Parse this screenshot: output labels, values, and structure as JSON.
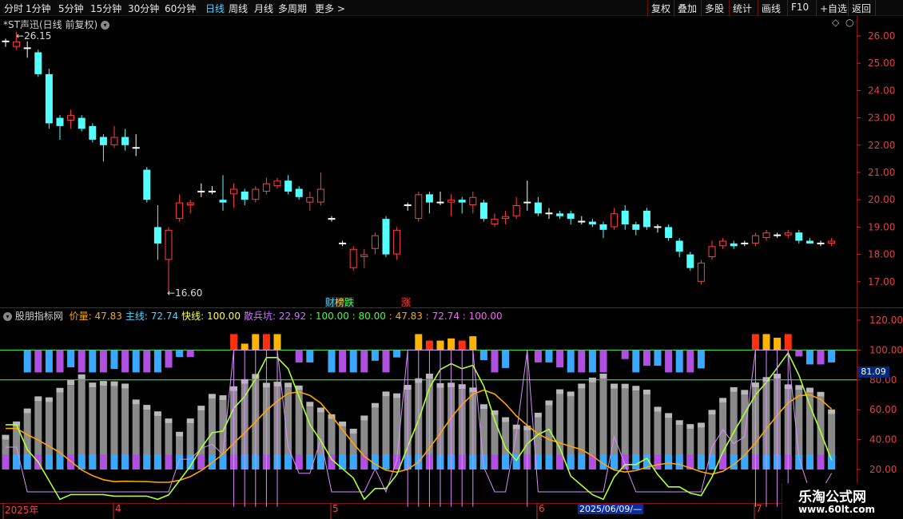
{
  "toolbar": {
    "periods": [
      "分时",
      "1分钟",
      "5分钟",
      "15分钟",
      "30分钟",
      "60分钟",
      "日线",
      "周线",
      "月线",
      "多周期",
      "更多 >"
    ],
    "active_period": "日线",
    "right_buttons": [
      "复权",
      "叠加",
      "多股",
      "统计",
      "画线",
      "F10",
      "+自选",
      "返回"
    ]
  },
  "main_chart": {
    "title": "*ST声迅(日线 前复权)",
    "high_label": "26.15",
    "low_label": "16.60",
    "event_labels": [
      {
        "text": "财",
        "color": "#2fd0ff"
      },
      {
        "text": "榜",
        "color": "#ffd21f"
      },
      {
        "text": "跌",
        "color": "#33ff55"
      },
      {
        "text": "涨",
        "color": "#ff3333"
      }
    ],
    "price_axis": [
      "26.00",
      "25.00",
      "24.00",
      "23.00",
      "22.00",
      "21.00",
      "20.00",
      "19.00",
      "18.00",
      "17.00"
    ]
  },
  "indicator": {
    "name": "股朋指标网",
    "items": [
      {
        "label": "价量:",
        "value": "47.83",
        "color": "#ffa500"
      },
      {
        "label": "主线:",
        "value": "72.74",
        "color": "#4fd2ff"
      },
      {
        "label": "快线:",
        "value": "100.00",
        "color": "#ffff40"
      },
      {
        "label": "散兵坑:",
        "value": "22.92",
        "color": "#d070ff"
      }
    ],
    "extra_values": [
      {
        "value": "100.00",
        "color": "#40ff40"
      },
      {
        "value": "80.00",
        "color": "#40ff40"
      },
      {
        "value": "47.83",
        "color": "#ffa500"
      },
      {
        "value": "72.74",
        "color": "#ff60ff"
      },
      {
        "value": "100.00",
        "color": "#ff60ff"
      }
    ],
    "axis": [
      "120.00",
      "100.00",
      "80.00",
      "60.00",
      "40.00",
      "20.00"
    ],
    "current_value": "81.09"
  },
  "date_axis": {
    "labels": [
      "2025年",
      "4",
      "5",
      "6",
      "7"
    ],
    "cursor_date": "2025/06/09/—"
  },
  "watermark": {
    "title": "乐淘公式网",
    "url": "www.60lt.com"
  },
  "chart_data": {
    "type": "candlestick",
    "title": "*ST声迅(日线 前复权)",
    "price_range": [
      16.6,
      26.15
    ],
    "candles": [
      {
        "o": 25.8,
        "c": 25.8,
        "h": 25.9,
        "l": 25.6
      },
      {
        "o": 25.6,
        "c": 25.8,
        "h": 26.15,
        "l": 25.5
      },
      {
        "o": 25.55,
        "c": 25.55,
        "h": 25.8,
        "l": 25.2
      },
      {
        "o": 25.4,
        "c": 24.6,
        "h": 25.5,
        "l": 24.5
      },
      {
        "o": 24.6,
        "c": 22.8,
        "h": 24.8,
        "l": 22.6
      },
      {
        "o": 23.0,
        "c": 22.7,
        "h": 23.1,
        "l": 22.2
      },
      {
        "o": 22.9,
        "c": 23.1,
        "h": 23.3,
        "l": 22.6
      },
      {
        "o": 23.0,
        "c": 22.6,
        "h": 23.1,
        "l": 22.5
      },
      {
        "o": 22.7,
        "c": 22.2,
        "h": 22.8,
        "l": 22.1
      },
      {
        "o": 22.3,
        "c": 22.0,
        "h": 22.4,
        "l": 21.4
      },
      {
        "o": 22.0,
        "c": 22.3,
        "h": 22.7,
        "l": 21.9
      },
      {
        "o": 22.3,
        "c": 22.0,
        "h": 22.6,
        "l": 21.8
      },
      {
        "o": 21.9,
        "c": 21.9,
        "h": 22.4,
        "l": 21.6
      },
      {
        "o": 21.1,
        "c": 20.0,
        "h": 21.2,
        "l": 19.9
      },
      {
        "o": 19.0,
        "c": 18.4,
        "h": 19.8,
        "l": 17.8
      },
      {
        "o": 17.8,
        "c": 18.9,
        "h": 19.0,
        "l": 16.6
      },
      {
        "o": 19.3,
        "c": 19.9,
        "h": 20.2,
        "l": 19.2
      },
      {
        "o": 19.8,
        "c": 19.9,
        "h": 20.0,
        "l": 19.5
      },
      {
        "o": 20.3,
        "c": 20.3,
        "h": 20.6,
        "l": 20.1
      },
      {
        "o": 20.3,
        "c": 20.3,
        "h": 20.5,
        "l": 20.2
      },
      {
        "o": 20.0,
        "c": 19.9,
        "h": 20.9,
        "l": 19.6
      },
      {
        "o": 20.2,
        "c": 20.4,
        "h": 20.6,
        "l": 19.7
      },
      {
        "o": 20.3,
        "c": 20.0,
        "h": 20.4,
        "l": 19.8
      },
      {
        "o": 20.0,
        "c": 20.4,
        "h": 20.5,
        "l": 19.9
      },
      {
        "o": 20.3,
        "c": 20.6,
        "h": 20.8,
        "l": 20.2
      },
      {
        "o": 20.5,
        "c": 20.7,
        "h": 20.8,
        "l": 20.4
      },
      {
        "o": 20.7,
        "c": 20.3,
        "h": 20.9,
        "l": 20.2
      },
      {
        "o": 20.4,
        "c": 20.1,
        "h": 20.5,
        "l": 20.0
      },
      {
        "o": 19.9,
        "c": 20.1,
        "h": 20.3,
        "l": 19.6
      },
      {
        "o": 19.9,
        "c": 20.4,
        "h": 21.0,
        "l": 19.8
      },
      {
        "o": 19.3,
        "c": 19.3,
        "h": 19.4,
        "l": 19.2
      },
      {
        "o": 18.4,
        "c": 18.4,
        "h": 18.5,
        "l": 18.3
      },
      {
        "o": 17.5,
        "c": 18.2,
        "h": 18.3,
        "l": 17.4
      },
      {
        "o": 17.9,
        "c": 18.0,
        "h": 18.2,
        "l": 17.5
      },
      {
        "o": 18.2,
        "c": 18.7,
        "h": 18.8,
        "l": 18.0
      },
      {
        "o": 19.3,
        "c": 18.0,
        "h": 19.4,
        "l": 17.9
      },
      {
        "o": 18.0,
        "c": 18.9,
        "h": 19.0,
        "l": 17.8
      },
      {
        "o": 19.8,
        "c": 19.8,
        "h": 19.9,
        "l": 19.6
      },
      {
        "o": 19.3,
        "c": 20.2,
        "h": 20.3,
        "l": 19.2
      },
      {
        "o": 20.2,
        "c": 19.9,
        "h": 20.3,
        "l": 19.5
      },
      {
        "o": 19.9,
        "c": 19.9,
        "h": 20.3,
        "l": 19.8
      },
      {
        "o": 19.9,
        "c": 20.0,
        "h": 20.2,
        "l": 19.4
      },
      {
        "o": 20.0,
        "c": 19.9,
        "h": 20.1,
        "l": 19.5
      },
      {
        "o": 19.8,
        "c": 20.1,
        "h": 20.3,
        "l": 19.5
      },
      {
        "o": 19.9,
        "c": 19.3,
        "h": 20.0,
        "l": 19.2
      },
      {
        "o": 19.1,
        "c": 19.3,
        "h": 19.5,
        "l": 19.0
      },
      {
        "o": 19.3,
        "c": 19.4,
        "h": 19.6,
        "l": 19.1
      },
      {
        "o": 19.4,
        "c": 19.8,
        "h": 20.1,
        "l": 19.3
      },
      {
        "o": 19.9,
        "c": 19.9,
        "h": 20.7,
        "l": 19.6
      },
      {
        "o": 19.9,
        "c": 19.5,
        "h": 20.1,
        "l": 19.4
      },
      {
        "o": 19.5,
        "c": 19.5,
        "h": 19.7,
        "l": 19.3
      },
      {
        "o": 19.5,
        "c": 19.4,
        "h": 19.6,
        "l": 19.3
      },
      {
        "o": 19.5,
        "c": 19.3,
        "h": 19.6,
        "l": 19.1
      },
      {
        "o": 19.2,
        "c": 19.2,
        "h": 19.4,
        "l": 19.1
      },
      {
        "o": 19.2,
        "c": 19.1,
        "h": 19.3,
        "l": 19.0
      },
      {
        "o": 19.1,
        "c": 18.9,
        "h": 19.2,
        "l": 18.6
      },
      {
        "o": 19.0,
        "c": 19.5,
        "h": 19.7,
        "l": 18.9
      },
      {
        "o": 19.6,
        "c": 19.1,
        "h": 19.8,
        "l": 18.9
      },
      {
        "o": 19.1,
        "c": 18.9,
        "h": 19.2,
        "l": 18.7
      },
      {
        "o": 19.6,
        "c": 19.0,
        "h": 19.7,
        "l": 18.9
      },
      {
        "o": 19.0,
        "c": 19.0,
        "h": 19.1,
        "l": 18.8
      },
      {
        "o": 19.0,
        "c": 18.6,
        "h": 19.1,
        "l": 18.5
      },
      {
        "o": 18.5,
        "c": 18.1,
        "h": 18.6,
        "l": 17.9
      },
      {
        "o": 18.0,
        "c": 17.5,
        "h": 18.1,
        "l": 17.4
      },
      {
        "o": 17.0,
        "c": 17.7,
        "h": 17.8,
        "l": 16.9
      },
      {
        "o": 17.9,
        "c": 18.3,
        "h": 18.5,
        "l": 17.8
      },
      {
        "o": 18.3,
        "c": 18.5,
        "h": 18.6,
        "l": 18.2
      },
      {
        "o": 18.4,
        "c": 18.3,
        "h": 18.5,
        "l": 18.2
      },
      {
        "o": 18.4,
        "c": 18.4,
        "h": 18.5,
        "l": 18.3
      },
      {
        "o": 18.4,
        "c": 18.7,
        "h": 18.8,
        "l": 18.3
      },
      {
        "o": 18.6,
        "c": 18.8,
        "h": 18.9,
        "l": 18.5
      },
      {
        "o": 18.7,
        "c": 18.7,
        "h": 18.8,
        "l": 18.6
      },
      {
        "o": 18.7,
        "c": 18.8,
        "h": 18.9,
        "l": 18.6
      },
      {
        "o": 18.8,
        "c": 18.5,
        "h": 18.9,
        "l": 18.4
      },
      {
        "o": 18.5,
        "c": 18.4,
        "h": 18.6,
        "l": 18.4
      },
      {
        "o": 18.4,
        "c": 18.4,
        "h": 18.5,
        "l": 18.3
      },
      {
        "o": 18.4,
        "c": 18.5,
        "h": 18.6,
        "l": 18.3
      }
    ]
  }
}
